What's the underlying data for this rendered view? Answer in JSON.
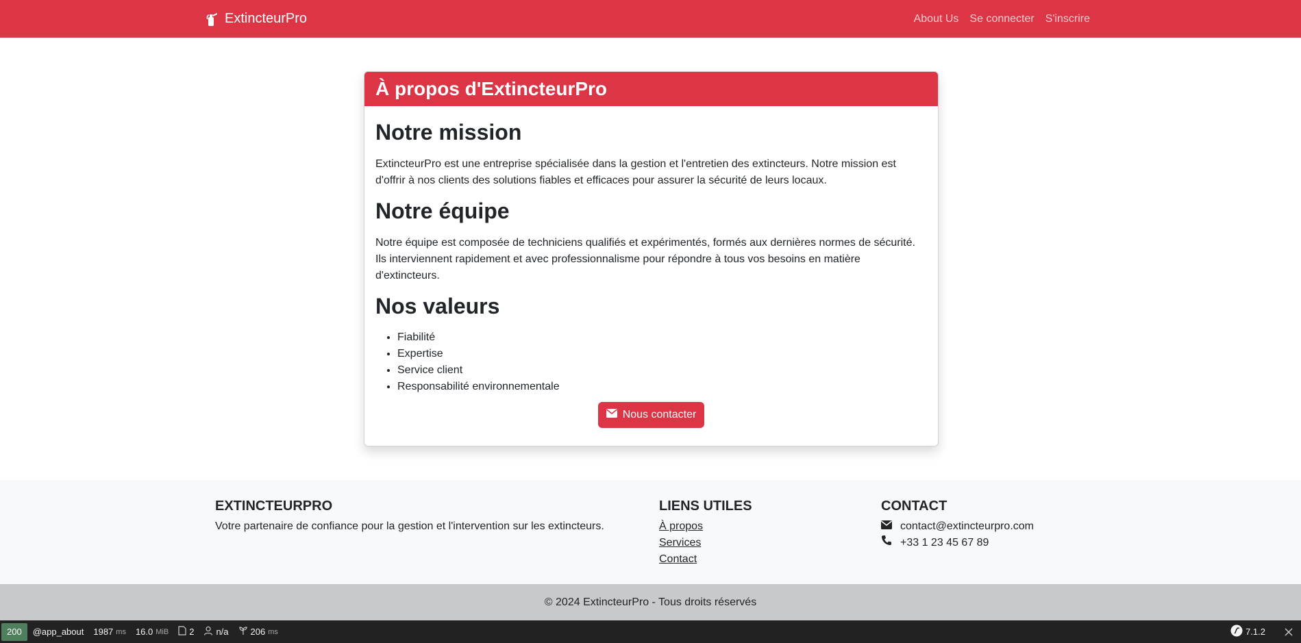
{
  "navbar": {
    "brand": "ExtincteurPro",
    "links": [
      "About Us",
      "Se connecter",
      "S'inscrire"
    ]
  },
  "card": {
    "title": "À propos d'ExtincteurPro",
    "sections": [
      {
        "heading": "Notre mission",
        "text": "ExtincteurPro est une entreprise spécialisée dans la gestion et l'entretien des extincteurs. Notre mission est d'offrir à nos clients des solutions fiables et efficaces pour assurer la sécurité de leurs locaux."
      },
      {
        "heading": "Notre équipe",
        "text": "Notre équipe est composée de techniciens qualifiés et expérimentés, formés aux dernières normes de sécurité. Ils interviennent rapidement et avec professionnalisme pour répondre à tous vos besoins en matière d'extincteurs."
      },
      {
        "heading": "Nos valeurs",
        "items": [
          "Fiabilité",
          "Expertise",
          "Service client",
          "Responsabilité environnementale"
        ]
      }
    ],
    "contact_button": "Nous contacter"
  },
  "footer": {
    "about": {
      "heading": "EXTINCTEURPRO",
      "text": "Votre partenaire de confiance pour la gestion et l'intervention sur les extincteurs."
    },
    "links": {
      "heading": "LIENS UTILES",
      "items": [
        "À propos",
        "Services",
        "Contact"
      ]
    },
    "contact": {
      "heading": "CONTACT",
      "email": "contact@extincteurpro.com",
      "phone": "+33 1 23 45 67 89"
    },
    "copyright": "© 2024 ExtincteurPro - Tous droits réservés"
  },
  "toolbar": {
    "status": "200",
    "route": "@app_about",
    "time": "1987",
    "time_unit": "ms",
    "memory": "16.0",
    "memory_unit": "MiB",
    "twig_count": "2",
    "user": "n/a",
    "render_time": "206",
    "render_unit": "ms",
    "symfony_version": "7.1.2"
  },
  "colors": {
    "primary": "#dc3545",
    "footer_bg": "#f8f9fa",
    "copyright_bg": "#c8c9cb",
    "toolbar_bg": "#222222",
    "status_ok": "#4f805d"
  }
}
